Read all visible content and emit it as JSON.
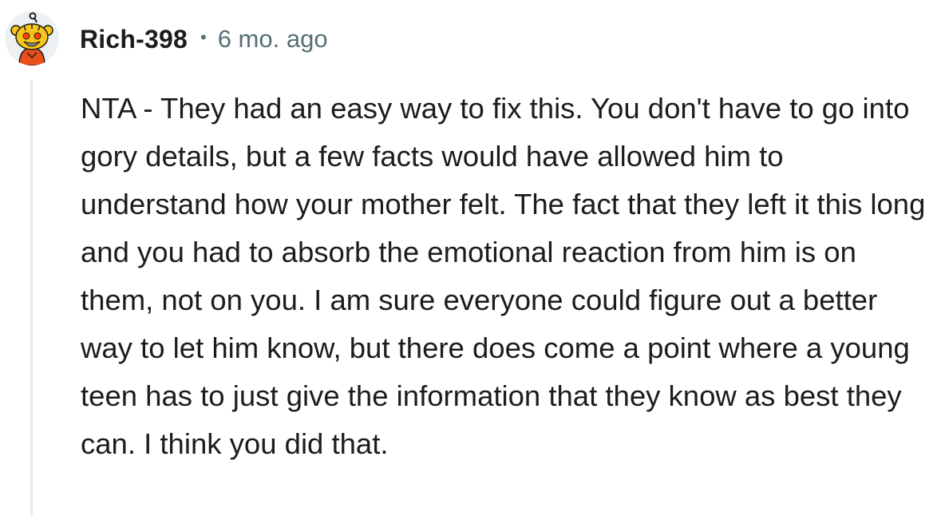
{
  "comment": {
    "username": "Rich-398",
    "separator": "•",
    "timestamp": "6 mo. ago",
    "avatar_icon": "snoo-avatar-icon",
    "body": "NTA - They had an easy way to fix this. You don't have to go into gory details, but a few facts would have allowed him to understand how your mother felt. The fact that they left it this long and you had to absorb the emotional reaction from him is on them, not on you. I am sure everyone could figure out a better way to let him know, but there does come a point where a young teen has to just give the information that they know as best they can. I think you did that."
  },
  "colors": {
    "text": "#1c1c1c",
    "meta": "#576f76",
    "thread_line": "#e5ebee",
    "avatar_accent": "#ff4500"
  }
}
